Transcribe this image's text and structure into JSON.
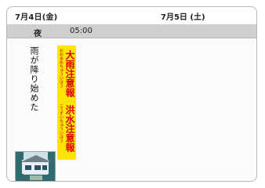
{
  "dates": {
    "left": "7月4日(金)",
    "right": "7月5日 (土)"
  },
  "time_row": {
    "period": "夜",
    "time": "05:00"
  },
  "forecast": {
    "main_text": "雨が降り始めた"
  },
  "warnings": [
    {
      "ruby": "おおあめちゅういほう",
      "label": "大雨注意報"
    },
    {
      "ruby": "こうずいちゅういほう",
      "label": "洪水注意報"
    }
  ],
  "image": {
    "icon": "scene-thumbnail",
    "accent_color": "#ffe500",
    "warning_text_color": "#e00000"
  }
}
